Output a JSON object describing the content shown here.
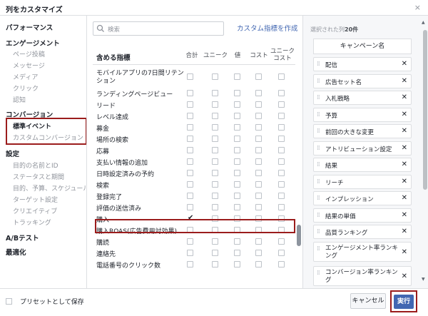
{
  "dialog": {
    "title": "列をカスタマイズ",
    "close": "×"
  },
  "sidebar": {
    "performance": "パフォーマンス",
    "engagement": "エンゲージメント",
    "engagement_items": [
      "ページ投稿",
      "メッセージ",
      "メディア",
      "クリック",
      "認知"
    ],
    "conversion": "コンバージョン",
    "conversion_items": [
      "標準イベント",
      "カスタムコンバージョン"
    ],
    "settings": "設定",
    "settings_items": [
      "目的の名前とID",
      "ステータスと期間",
      "目的、予算、スケジュール",
      "ターゲット設定",
      "クリエイティブ",
      "トラッキング"
    ],
    "ab_test": "A/Bテスト",
    "optimization": "最適化"
  },
  "middle": {
    "search_placeholder": "検索",
    "create_metric": "カスタム指標を作成",
    "include_metrics": "含める指標",
    "columns": [
      "合計",
      "ユニーク",
      "値",
      "コスト",
      "ユニーク\nコスト"
    ],
    "rows": [
      {
        "label": "モバイルアプリの7日間リテンション",
        "two_line": true,
        "checked": [
          false,
          false,
          false,
          false,
          false
        ]
      },
      {
        "label": "ランディングページビュー",
        "checked": [
          false,
          false,
          false,
          false,
          false
        ]
      },
      {
        "label": "リード",
        "checked": [
          false,
          false,
          false,
          false,
          false
        ]
      },
      {
        "label": "レベル達成",
        "checked": [
          false,
          false,
          false,
          false,
          false
        ]
      },
      {
        "label": "募金",
        "checked": [
          false,
          false,
          false,
          false,
          false
        ]
      },
      {
        "label": "場所の検索",
        "checked": [
          false,
          false,
          false,
          false,
          false
        ]
      },
      {
        "label": "応募",
        "checked": [
          false,
          false,
          false,
          false,
          false
        ]
      },
      {
        "label": "支払い情報の追加",
        "checked": [
          false,
          false,
          false,
          false,
          false
        ]
      },
      {
        "label": "日時設定済みの予約",
        "checked": [
          false,
          false,
          false,
          false,
          false
        ]
      },
      {
        "label": "検索",
        "checked": [
          false,
          false,
          false,
          false,
          false
        ]
      },
      {
        "label": "登録完了",
        "checked": [
          false,
          false,
          false,
          false,
          false
        ]
      },
      {
        "label": "評価の送信済み",
        "checked": [
          false,
          false,
          false,
          false,
          false
        ]
      },
      {
        "label": "購入",
        "checked": [
          true,
          false,
          false,
          false,
          false
        ]
      },
      {
        "label": "購入ROAS(広告費用対効果)",
        "checked": [
          false,
          false,
          false,
          false,
          false
        ]
      },
      {
        "label": "購読",
        "checked": [
          false,
          false,
          false,
          false,
          false
        ]
      },
      {
        "label": "連絡先",
        "checked": [
          false,
          false,
          false,
          false,
          false
        ]
      },
      {
        "label": "電話番号のクリック数",
        "checked": [
          false,
          false,
          false,
          false,
          false
        ]
      }
    ]
  },
  "right": {
    "heading_prefix": "選択された列",
    "heading_count": "20件",
    "fixed_column": "キャンペーン名",
    "selected": [
      "配信",
      "広告セット名",
      "入札戦略",
      "予算",
      "前回の大きな変更",
      "アトリビューション設定",
      "結果",
      "リーチ",
      "インプレッション",
      "結果の単価",
      "品質ランキング",
      "エンゲージメント率ランキング",
      "コンバージョン率ランキング"
    ]
  },
  "footer": {
    "save_preset": "プリセットとして保存",
    "cancel": "キャンセル",
    "apply": "実行"
  }
}
